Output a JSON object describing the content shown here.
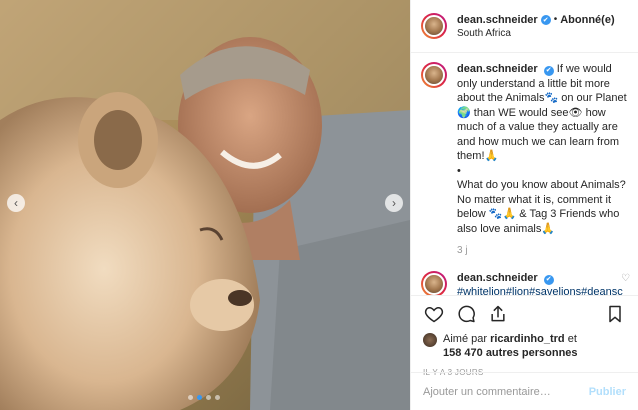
{
  "header": {
    "username": "dean.schneider",
    "separator": "•",
    "follow_status": "Abonné(e)",
    "location": "South Africa",
    "verified_icon": "✔"
  },
  "caption": {
    "username": "dean.schneider",
    "text_1": "If we would only understand a little bit more about the Animals",
    "text_2": " on our Planet",
    "text_3": " than WE would see",
    "text_4": " how much of a value they actually are and how much we can learn from them!",
    "bullet": "•",
    "text_5": "What do you know about Animals? No matter what it is, comment it below ",
    "text_6": " & Tag 3 Friends who also love animals",
    "emoji_paws": "🐾",
    "emoji_globe": "🌍",
    "emoji_eye": "👁",
    "emoji_hands": "🙏",
    "time": "3 j"
  },
  "comment": {
    "username": "dean.schneider",
    "hashtags": "#whitelion#lion#savelions#deanschneider#hakunamipaka#nolimits#moderneducation#educationn#loveanimals#lovewildlife#ou",
    "heart": "♡"
  },
  "actions": {
    "like_icon": "heart-icon",
    "comment_icon": "comment-icon",
    "share_icon": "share-icon",
    "save_icon": "bookmark-icon"
  },
  "likes": {
    "prefix": "Aimé par ",
    "user": "ricardinho_trd",
    "middle": " et",
    "count": "158 470 autres personnes"
  },
  "timestamp": "IL Y A 3 JOURS",
  "add_comment": {
    "placeholder": "Ajouter un commentaire…",
    "publish": "Publier"
  },
  "carousel": {
    "prev": "‹",
    "next": "›",
    "slide_count": 4,
    "active_slide": 2
  },
  "colors": {
    "accent": "#3897f0",
    "hashtag": "#003569",
    "publish_disabled": "#b2dffc"
  }
}
